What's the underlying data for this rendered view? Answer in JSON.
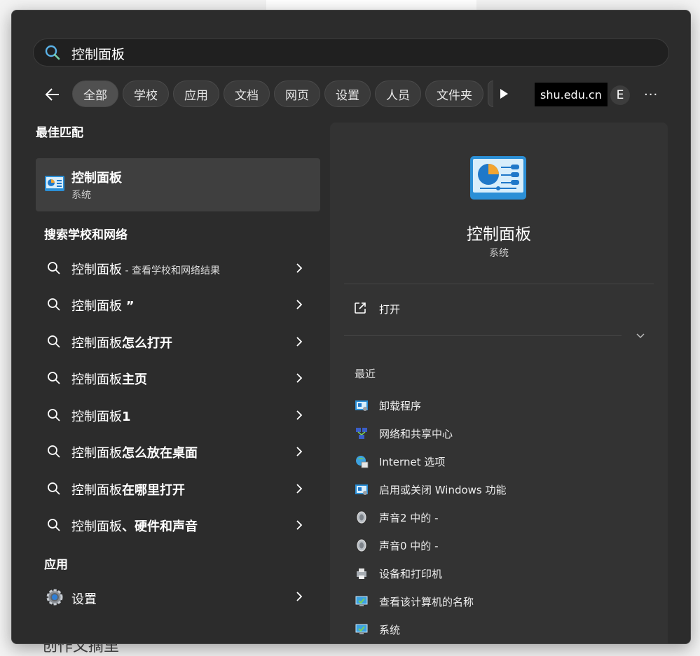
{
  "search": {
    "value": "控制面板"
  },
  "filters": {
    "chips": [
      "全部",
      "学校",
      "应用",
      "文档",
      "网页",
      "设置",
      "人员",
      "文件夹"
    ],
    "domain": "shu.edu.cn",
    "avatar": "E",
    "more": "···"
  },
  "best_match": {
    "title": "最佳匹配",
    "name": "控制面板",
    "sub": "系统"
  },
  "web": {
    "title": "搜索学校和网络",
    "items": [
      {
        "pre": "控制面板",
        "bold": "",
        "note": " - 查看学校和网络结果"
      },
      {
        "pre": "控制面板 ",
        "bold": "”",
        "note": ""
      },
      {
        "pre": "控制面板",
        "bold": "怎么打开",
        "note": ""
      },
      {
        "pre": "控制面板",
        "bold": "主页",
        "note": ""
      },
      {
        "pre": "控制面板",
        "bold": "1",
        "note": ""
      },
      {
        "pre": "控制面板",
        "bold": "怎么放在桌面",
        "note": ""
      },
      {
        "pre": "控制面板",
        "bold": "在哪里打开",
        "note": ""
      },
      {
        "pre": "控制面板",
        "bold": "、硬件和声音",
        "note": ""
      }
    ]
  },
  "apps": {
    "title": "应用",
    "item": "设置"
  },
  "preview": {
    "name": "控制面板",
    "sub": "系统",
    "open": "打开",
    "recent_title": "最近",
    "recent": [
      {
        "label": "卸载程序",
        "icon": "programs-icon"
      },
      {
        "label": "网络和共享中心",
        "icon": "network-icon"
      },
      {
        "label": "Internet 选项",
        "icon": "internet-options-icon"
      },
      {
        "label": "启用或关闭 Windows 功能",
        "icon": "windows-features-icon"
      },
      {
        "label": "声音2 中的 -",
        "icon": "sound-icon"
      },
      {
        "label": "声音0 中的 -",
        "icon": "sound-icon"
      },
      {
        "label": "设备和打印机",
        "icon": "printer-icon"
      },
      {
        "label": "查看该计算机的名称",
        "icon": "computer-icon"
      },
      {
        "label": "系统",
        "icon": "computer-icon"
      }
    ]
  },
  "background_text": "创作文摘里"
}
